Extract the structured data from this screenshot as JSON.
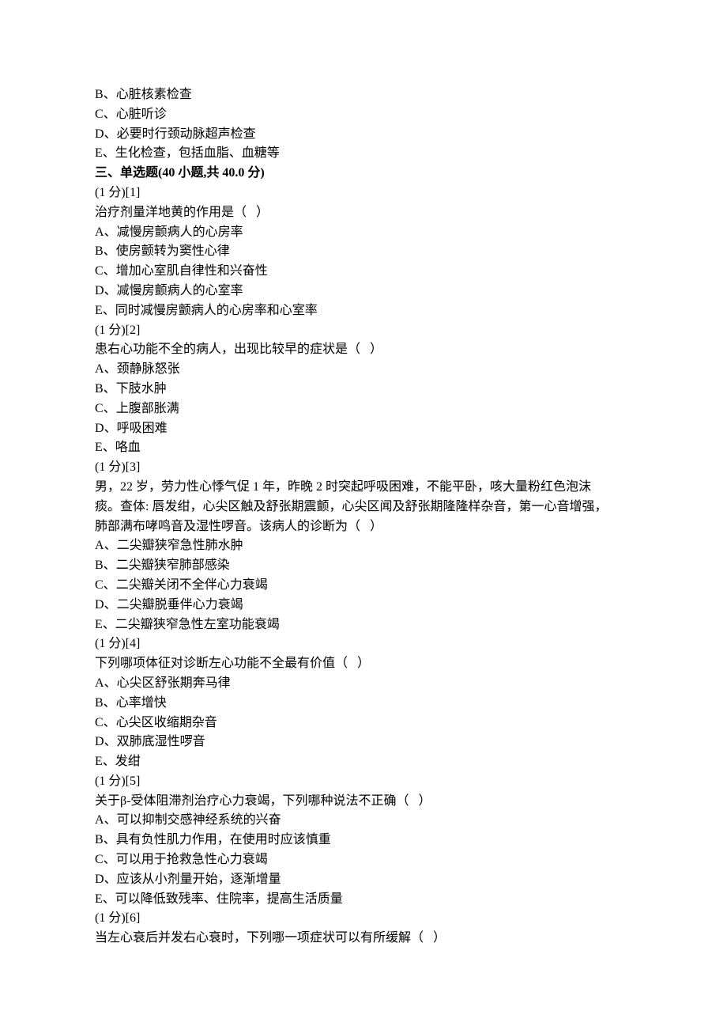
{
  "prequel_options": [
    {
      "letter": "B",
      "text": "心脏核素检查"
    },
    {
      "letter": "C",
      "text": "心脏听诊"
    },
    {
      "letter": "D",
      "text": "必要时行颈动脉超声检查"
    },
    {
      "letter": "E",
      "text": "生化检查，包括血脂、血糖等"
    }
  ],
  "section_header": "三、单选题(40 小题,共 40.0 分)",
  "common": {
    "marker_prefix": "(1 分)[",
    "marker_suffix": "]",
    "stem_suffix": "（   ）",
    "option_sep": "、"
  },
  "questions": [
    {
      "n": "1",
      "stem": "治疗剂量洋地黄的作用是",
      "options": [
        {
          "letter": "A",
          "text": "减慢房颤病人的心房率"
        },
        {
          "letter": "B",
          "text": "使房颤转为窦性心律"
        },
        {
          "letter": "C",
          "text": "增加心室肌自律性和兴奋性"
        },
        {
          "letter": "D",
          "text": "减慢房颤病人的心室率"
        },
        {
          "letter": "E",
          "text": "同时减慢房颤病人的心房率和心室率"
        }
      ]
    },
    {
      "n": "2",
      "stem": "患右心功能不全的病人，出现比较早的症状是",
      "options": [
        {
          "letter": "A",
          "text": "颈静脉怒张"
        },
        {
          "letter": "B",
          "text": "下肢水肿"
        },
        {
          "letter": "C",
          "text": "上腹部胀满"
        },
        {
          "letter": "D",
          "text": "呼吸困难"
        },
        {
          "letter": "E",
          "text": "咯血"
        }
      ]
    },
    {
      "n": "3",
      "stem_lines": [
        "男，22 岁，劳力性心悸气促 1 年，昨晚 2 时突起呼吸困难，不能平卧，咳大量粉红色泡沫",
        "痰。查体: 唇发绀，心尖区触及舒张期震颤，心尖区闻及舒张期隆隆样杂音，第一心音增强，",
        "肺部满布哮鸣音及湿性啰音。该病人的诊断为（   ）"
      ],
      "options": [
        {
          "letter": "A",
          "text": "二尖瓣狭窄急性肺水肿"
        },
        {
          "letter": "B",
          "text": "二尖瓣狭窄肺部感染"
        },
        {
          "letter": "C",
          "text": "二尖瓣关闭不全伴心力衰竭"
        },
        {
          "letter": "D",
          "text": "二尖瓣脱垂伴心力衰竭"
        },
        {
          "letter": "E",
          "text": "二尖瓣狭窄急性左室功能衰竭"
        }
      ]
    },
    {
      "n": "4",
      "stem": "下列哪项体征对诊断左心功能不全最有价值",
      "options": [
        {
          "letter": "A",
          "text": "心尖区舒张期奔马律"
        },
        {
          "letter": "B",
          "text": "心率增快"
        },
        {
          "letter": "C",
          "text": "心尖区收缩期杂音"
        },
        {
          "letter": "D",
          "text": "双肺底湿性啰音"
        },
        {
          "letter": "E",
          "text": "发绀"
        }
      ]
    },
    {
      "n": "5",
      "stem": "关于β-受体阻滞剂治疗心力衰竭，下列哪种说法不正确",
      "options": [
        {
          "letter": "A",
          "text": "可以抑制交感神经系统的兴奋"
        },
        {
          "letter": "B",
          "text": "具有负性肌力作用，在使用时应该慎重"
        },
        {
          "letter": "C",
          "text": "可以用于抢救急性心力衰竭"
        },
        {
          "letter": "D",
          "text": "应该从小剂量开始，逐渐增量"
        },
        {
          "letter": "E",
          "text": "可以降低致残率、住院率，提高生活质量"
        }
      ]
    },
    {
      "n": "6",
      "stem": "当左心衰后并发右心衰时，下列哪一项症状可以有所缓解",
      "options": []
    }
  ]
}
